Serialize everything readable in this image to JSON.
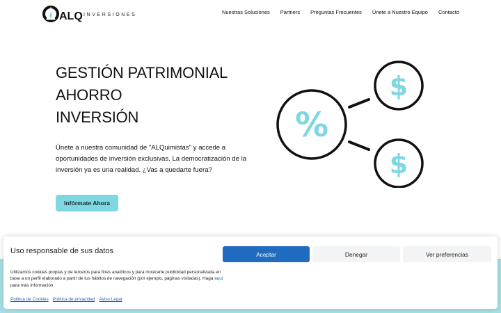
{
  "brand": {
    "logo_letters": "ALQ",
    "logo_sub": "INVERSIONES"
  },
  "nav": {
    "items": [
      {
        "label": "Nuestras Soluciones"
      },
      {
        "label": "Partners"
      },
      {
        "label": "Preguntas Frecuentes"
      },
      {
        "label": "Únete a Nuestro Equipo"
      },
      {
        "label": "Contacto"
      }
    ]
  },
  "hero": {
    "title_lines": [
      "GESTIÓN PATRIMONIAL",
      "AHORRO",
      "INVERSIÓN"
    ],
    "body": "Únete a nuestra comunidad de \"ALQuimistas\" y accede a oportunidades de inversión exclusivas. La democratización de la inversión ya es una realidad. ¿Vas a quedarte fuera?",
    "cta_label": "Infórmate Ahora",
    "illustration": {
      "center_symbol": "%",
      "node_symbol": "$",
      "accent_color": "#7fd7e1"
    }
  },
  "cookie_banner": {
    "title": "Uso responsable de sus datos",
    "text_before_link": "Utilizamos cookies propias y de terceros para fines analíticos y para mostrarte publicidad personalizada en base a un perfil elaborado a partir de tus hábitos de navegación (por ejemplo, páginas visitadas). Haga ",
    "text_link": "aquí",
    "text_after_link": " para más información.",
    "accept_label": "Aceptar",
    "deny_label": "Denegar",
    "prefs_label": "Ver preferencias",
    "links": [
      {
        "label": "Política de Cookies"
      },
      {
        "label": "Política de privacidad"
      },
      {
        "label": "Aviso Legal"
      }
    ]
  },
  "colors": {
    "accent": "#7fd7e1",
    "primary_button": "#1f6bbf",
    "link": "#1b63b5"
  }
}
